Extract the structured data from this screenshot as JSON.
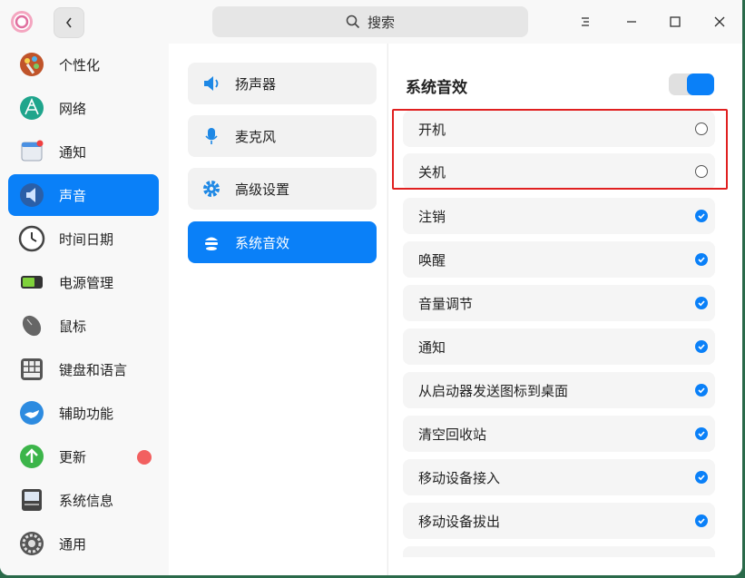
{
  "titlebar": {
    "search_label": "搜索",
    "icons": [
      "app-logo-icon",
      "back-icon",
      "search-icon",
      "menu-icon",
      "minimize-icon",
      "maximize-icon",
      "close-icon"
    ]
  },
  "sidebar": {
    "items": [
      {
        "label": "个性化",
        "icon": "personalization-icon",
        "active": false
      },
      {
        "label": "网络",
        "icon": "network-icon",
        "active": false
      },
      {
        "label": "通知",
        "icon": "notification-icon",
        "active": false
      },
      {
        "label": "声音",
        "icon": "sound-icon",
        "active": true
      },
      {
        "label": "时间日期",
        "icon": "clock-icon",
        "active": false
      },
      {
        "label": "电源管理",
        "icon": "battery-icon",
        "active": false
      },
      {
        "label": "鼠标",
        "icon": "mouse-icon",
        "active": false
      },
      {
        "label": "键盘和语言",
        "icon": "keyboard-icon",
        "active": false
      },
      {
        "label": "辅助功能",
        "icon": "accessibility-icon",
        "active": false
      },
      {
        "label": "更新",
        "icon": "update-icon",
        "active": false,
        "badge": true
      },
      {
        "label": "系统信息",
        "icon": "system-info-icon",
        "active": false
      },
      {
        "label": "通用",
        "icon": "general-icon",
        "active": false
      }
    ]
  },
  "subnav": {
    "items": [
      {
        "label": "扬声器",
        "icon": "speaker-icon",
        "active": false
      },
      {
        "label": "麦克风",
        "icon": "microphone-icon",
        "active": false
      },
      {
        "label": "高级设置",
        "icon": "gear-icon",
        "active": false
      },
      {
        "label": "系统音效",
        "icon": "system-sound-icon",
        "active": true
      }
    ]
  },
  "main": {
    "title": "系统音效",
    "toggle_on": true,
    "rows": [
      {
        "label": "开机",
        "checked": false
      },
      {
        "label": "关机",
        "checked": false
      },
      {
        "label": "注销",
        "checked": true
      },
      {
        "label": "唤醒",
        "checked": true
      },
      {
        "label": "音量调节",
        "checked": true
      },
      {
        "label": "通知",
        "checked": true
      },
      {
        "label": "从启动器发送图标到桌面",
        "checked": true
      },
      {
        "label": "清空回收站",
        "checked": true
      },
      {
        "label": "移动设备接入",
        "checked": true
      },
      {
        "label": "移动设备拔出",
        "checked": true
      }
    ]
  },
  "colors": {
    "accent": "#0a80f8",
    "highlight_box": "#e02020",
    "badge": "#f26060"
  }
}
